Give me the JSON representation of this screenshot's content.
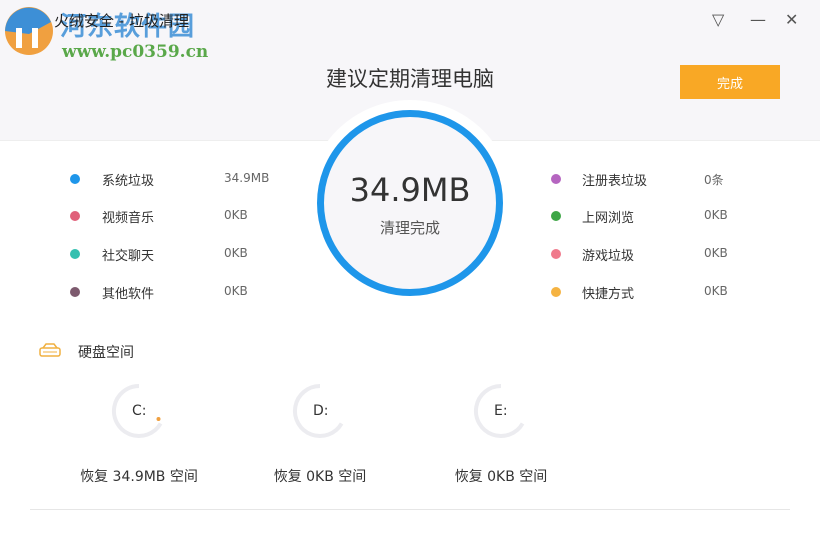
{
  "window": {
    "title": "火绒安全 - 垃圾清理",
    "watermark_name": "河东软件园",
    "watermark_url": "www.pc0359.cn"
  },
  "controls": {
    "menu": "▽",
    "minimize": "—",
    "close": "✕"
  },
  "header": {
    "headline": "建议定期清理电脑",
    "done_label": "完成"
  },
  "summary": {
    "size": "34.9MB",
    "status": "清理完成"
  },
  "categories_left": [
    {
      "label": "系统垃圾",
      "value": "34.9MB",
      "color": "#1e96ea"
    },
    {
      "label": "视频音乐",
      "value": "0KB",
      "color": "#e0607a"
    },
    {
      "label": "社交聊天",
      "value": "0KB",
      "color": "#34c0b0"
    },
    {
      "label": "其他软件",
      "value": "0KB",
      "color": "#7d5a6e"
    }
  ],
  "categories_right": [
    {
      "label": "注册表垃圾",
      "value": "0条",
      "color": "#b565c0"
    },
    {
      "label": "上网浏览",
      "value": "0KB",
      "color": "#3ea646"
    },
    {
      "label": "游戏垃圾",
      "value": "0KB",
      "color": "#f07a8c"
    },
    {
      "label": "快捷方式",
      "value": "0KB",
      "color": "#f5b342"
    }
  ],
  "disk": {
    "title": "硬盘空间",
    "drives": [
      {
        "label": "C:",
        "recovered": "恢复 34.9MB 空间"
      },
      {
        "label": "D:",
        "recovered": "恢复 0KB 空间"
      },
      {
        "label": "E:",
        "recovered": "恢复 0KB 空间"
      }
    ]
  }
}
